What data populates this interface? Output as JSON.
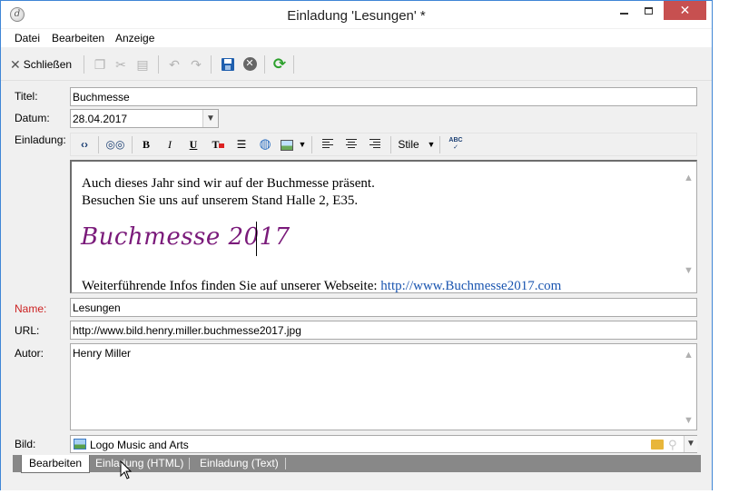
{
  "window": {
    "title": "Einladung 'Lesungen' *",
    "close_glyph": "✕"
  },
  "menu": [
    "Datei",
    "Bearbeiten",
    "Anzeige"
  ],
  "toolbar": {
    "close_label": "Schließen",
    "icons": [
      "copy-icon",
      "cut-icon",
      "paste-icon",
      "undo-icon",
      "redo-icon",
      "save-icon",
      "cancel-icon",
      "refresh-icon"
    ]
  },
  "form": {
    "title_label": "Titel:",
    "title_value": "Buchmesse",
    "date_label": "Datum:",
    "date_value": "28.04.2017",
    "invite_label": "Einladung:",
    "name_label": "Name:",
    "name_value": "Lesungen",
    "url_label": "URL:",
    "url_value": "http://www.bild.henry.miller.buchmesse2017.jpg",
    "author_label": "Autor:",
    "author_value": "Henry Miller",
    "image_label": "Bild:",
    "image_value": "Logo Music and Arts"
  },
  "editor_toolbar": {
    "bold": "B",
    "italic": "I",
    "underline": "U",
    "style_label": "Stile",
    "spell": "ABC"
  },
  "editor": {
    "line1": "Auch dieses Jahr sind wir auf der Buchmesse präsent.",
    "line2": "Besuchen Sie uns auf unserem Stand Halle 2, E35.",
    "heading": "Buchmesse 2017",
    "info_text": "Weiterführende Infos finden Sie auf unserer Webseite: ",
    "link_text": "http://www.Buchmesse2017.com"
  },
  "tabs": [
    "Bearbeiten",
    "Einladung (HTML)",
    "Einladung (Text)"
  ],
  "colors": {
    "heading": "#7a1a7a",
    "link": "#1a55b0",
    "close_button": "#c75050",
    "required_label": "#cc2222"
  }
}
